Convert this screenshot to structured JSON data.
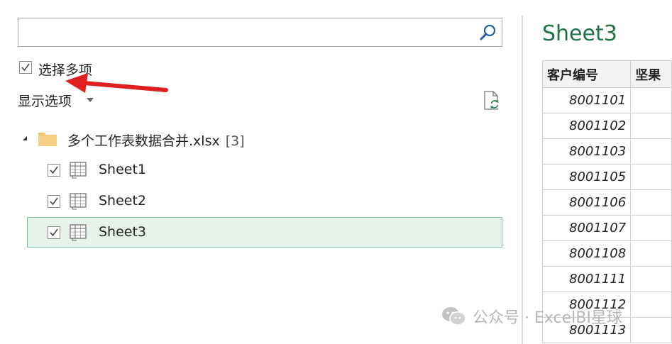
{
  "search": {
    "value": "",
    "placeholder": ""
  },
  "options": {
    "multi_select_label": "选择多项",
    "multi_select_checked": true,
    "display_options_label": "显示选项"
  },
  "tree": {
    "root_label": "多个工作表数据合并.xlsx",
    "root_count": "[3]",
    "items": [
      {
        "label": "Sheet1",
        "checked": true,
        "selected": false
      },
      {
        "label": "Sheet2",
        "checked": true,
        "selected": false
      },
      {
        "label": "Sheet3",
        "checked": true,
        "selected": true
      }
    ]
  },
  "preview": {
    "title": "Sheet3",
    "columns": [
      "客户编号",
      "坚果"
    ],
    "rows": [
      [
        "8001101",
        ""
      ],
      [
        "8001102",
        ""
      ],
      [
        "8001103",
        ""
      ],
      [
        "8001105",
        ""
      ],
      [
        "8001106",
        ""
      ],
      [
        "8001107",
        ""
      ],
      [
        "8001108",
        ""
      ],
      [
        "8001111",
        ""
      ],
      [
        "8001112",
        ""
      ],
      [
        "8001113",
        ""
      ]
    ]
  },
  "watermark": {
    "text": "公众号 · ExcelBI星球"
  },
  "icons": {
    "search": "search-icon",
    "refresh": "refresh-file-icon",
    "folder": "folder-icon",
    "sheet": "table-sheet-icon",
    "annotation": "red-arrow-icon"
  },
  "colors": {
    "accent_green": "#217346",
    "selection_bg": "#e6f2ea",
    "selection_border": "#80c29a",
    "arrow_red": "#e02020",
    "folder": "#f0c36d"
  }
}
